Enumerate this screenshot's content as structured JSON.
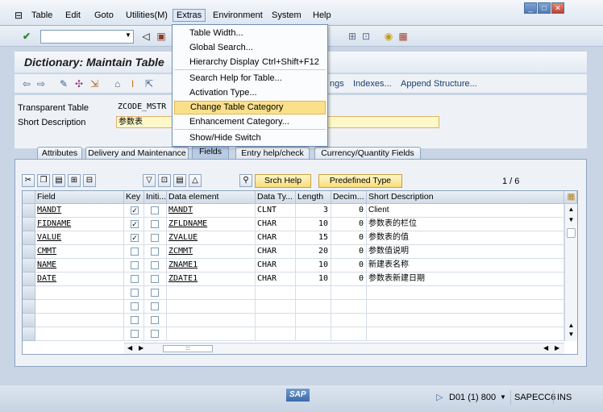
{
  "menubar": {
    "items": [
      "Table",
      "Edit",
      "Goto",
      "Utilities(M)",
      "Extras",
      "Environment",
      "System",
      "Help"
    ]
  },
  "window_buttons": [
    "minimize",
    "maximize",
    "close"
  ],
  "toolbar1": {
    "command_field": ""
  },
  "title": "Dictionary: Maintain Table",
  "toolbar2": {
    "links": [
      "ngs",
      "Indexes...",
      "Append Structure..."
    ]
  },
  "fields": {
    "transparent_table_label": "Transparent Table",
    "transparent_table_value": "ZCODE_MSTR",
    "short_description_label": "Short Description",
    "short_description_value": "参数表"
  },
  "tabs": [
    "Attributes",
    "Delivery and Maintenance",
    "Fields",
    "Entry help/check",
    "Currency/Quantity Fields"
  ],
  "selected_tab": "Fields",
  "panel": {
    "srch_help_label": "Srch Help",
    "predefined_type_label": "Predefined Type",
    "page_counter": "1  /  6"
  },
  "grid": {
    "headers": [
      "Field",
      "Key",
      "Initi...",
      "Data element",
      "Data Ty...",
      "Length",
      "Decim...",
      "Short Description"
    ],
    "rows": [
      {
        "field": "MANDT",
        "key": true,
        "init": false,
        "data_element": "MANDT",
        "data_type": "CLNT",
        "length": "3",
        "decimals": "0",
        "short_desc": "Client"
      },
      {
        "field": "FIDNAME",
        "key": true,
        "init": false,
        "data_element": "ZFLDNAME",
        "data_type": "CHAR",
        "length": "10",
        "decimals": "0",
        "short_desc": "参数表的栏位"
      },
      {
        "field": "VALUE",
        "key": true,
        "init": false,
        "data_element": "ZVALUE",
        "data_type": "CHAR",
        "length": "15",
        "decimals": "0",
        "short_desc": "参数表的值"
      },
      {
        "field": "CMMT",
        "key": false,
        "init": false,
        "data_element": "ZCMMT",
        "data_type": "CHAR",
        "length": "20",
        "decimals": "0",
        "short_desc": "参数值说明"
      },
      {
        "field": "NAME",
        "key": false,
        "init": false,
        "data_element": "ZNAME1",
        "data_type": "CHAR",
        "length": "10",
        "decimals": "0",
        "short_desc": "新建表名称"
      },
      {
        "field": "DATE",
        "key": false,
        "init": false,
        "data_element": "ZDATE1",
        "data_type": "CHAR",
        "length": "10",
        "decimals": "0",
        "short_desc": "参数表新建日期"
      }
    ],
    "empty_rows": 4
  },
  "dropdown": {
    "items": [
      {
        "label": "Table Width...",
        "shortcut": ""
      },
      {
        "label": "Global Search...",
        "shortcut": ""
      },
      {
        "label": "Hierarchy Display",
        "shortcut": "Ctrl+Shift+F12"
      },
      {
        "label": "Search Help for Table...",
        "shortcut": ""
      },
      {
        "label": "Activation Type...",
        "shortcut": ""
      },
      {
        "label": "Change Table Category",
        "shortcut": ""
      },
      {
        "label": "Enhancement Category...",
        "shortcut": ""
      },
      {
        "label": "Show/Hide Switch",
        "shortcut": ""
      }
    ],
    "highlighted": "Change Table Category"
  },
  "statusbar": {
    "logo": "SAP",
    "system": "D01 (1) 800",
    "server": "SAPECC6",
    "mode": "INS"
  },
  "colors": {
    "highlight": "#fbe08a",
    "background": "#c9d5e5"
  }
}
